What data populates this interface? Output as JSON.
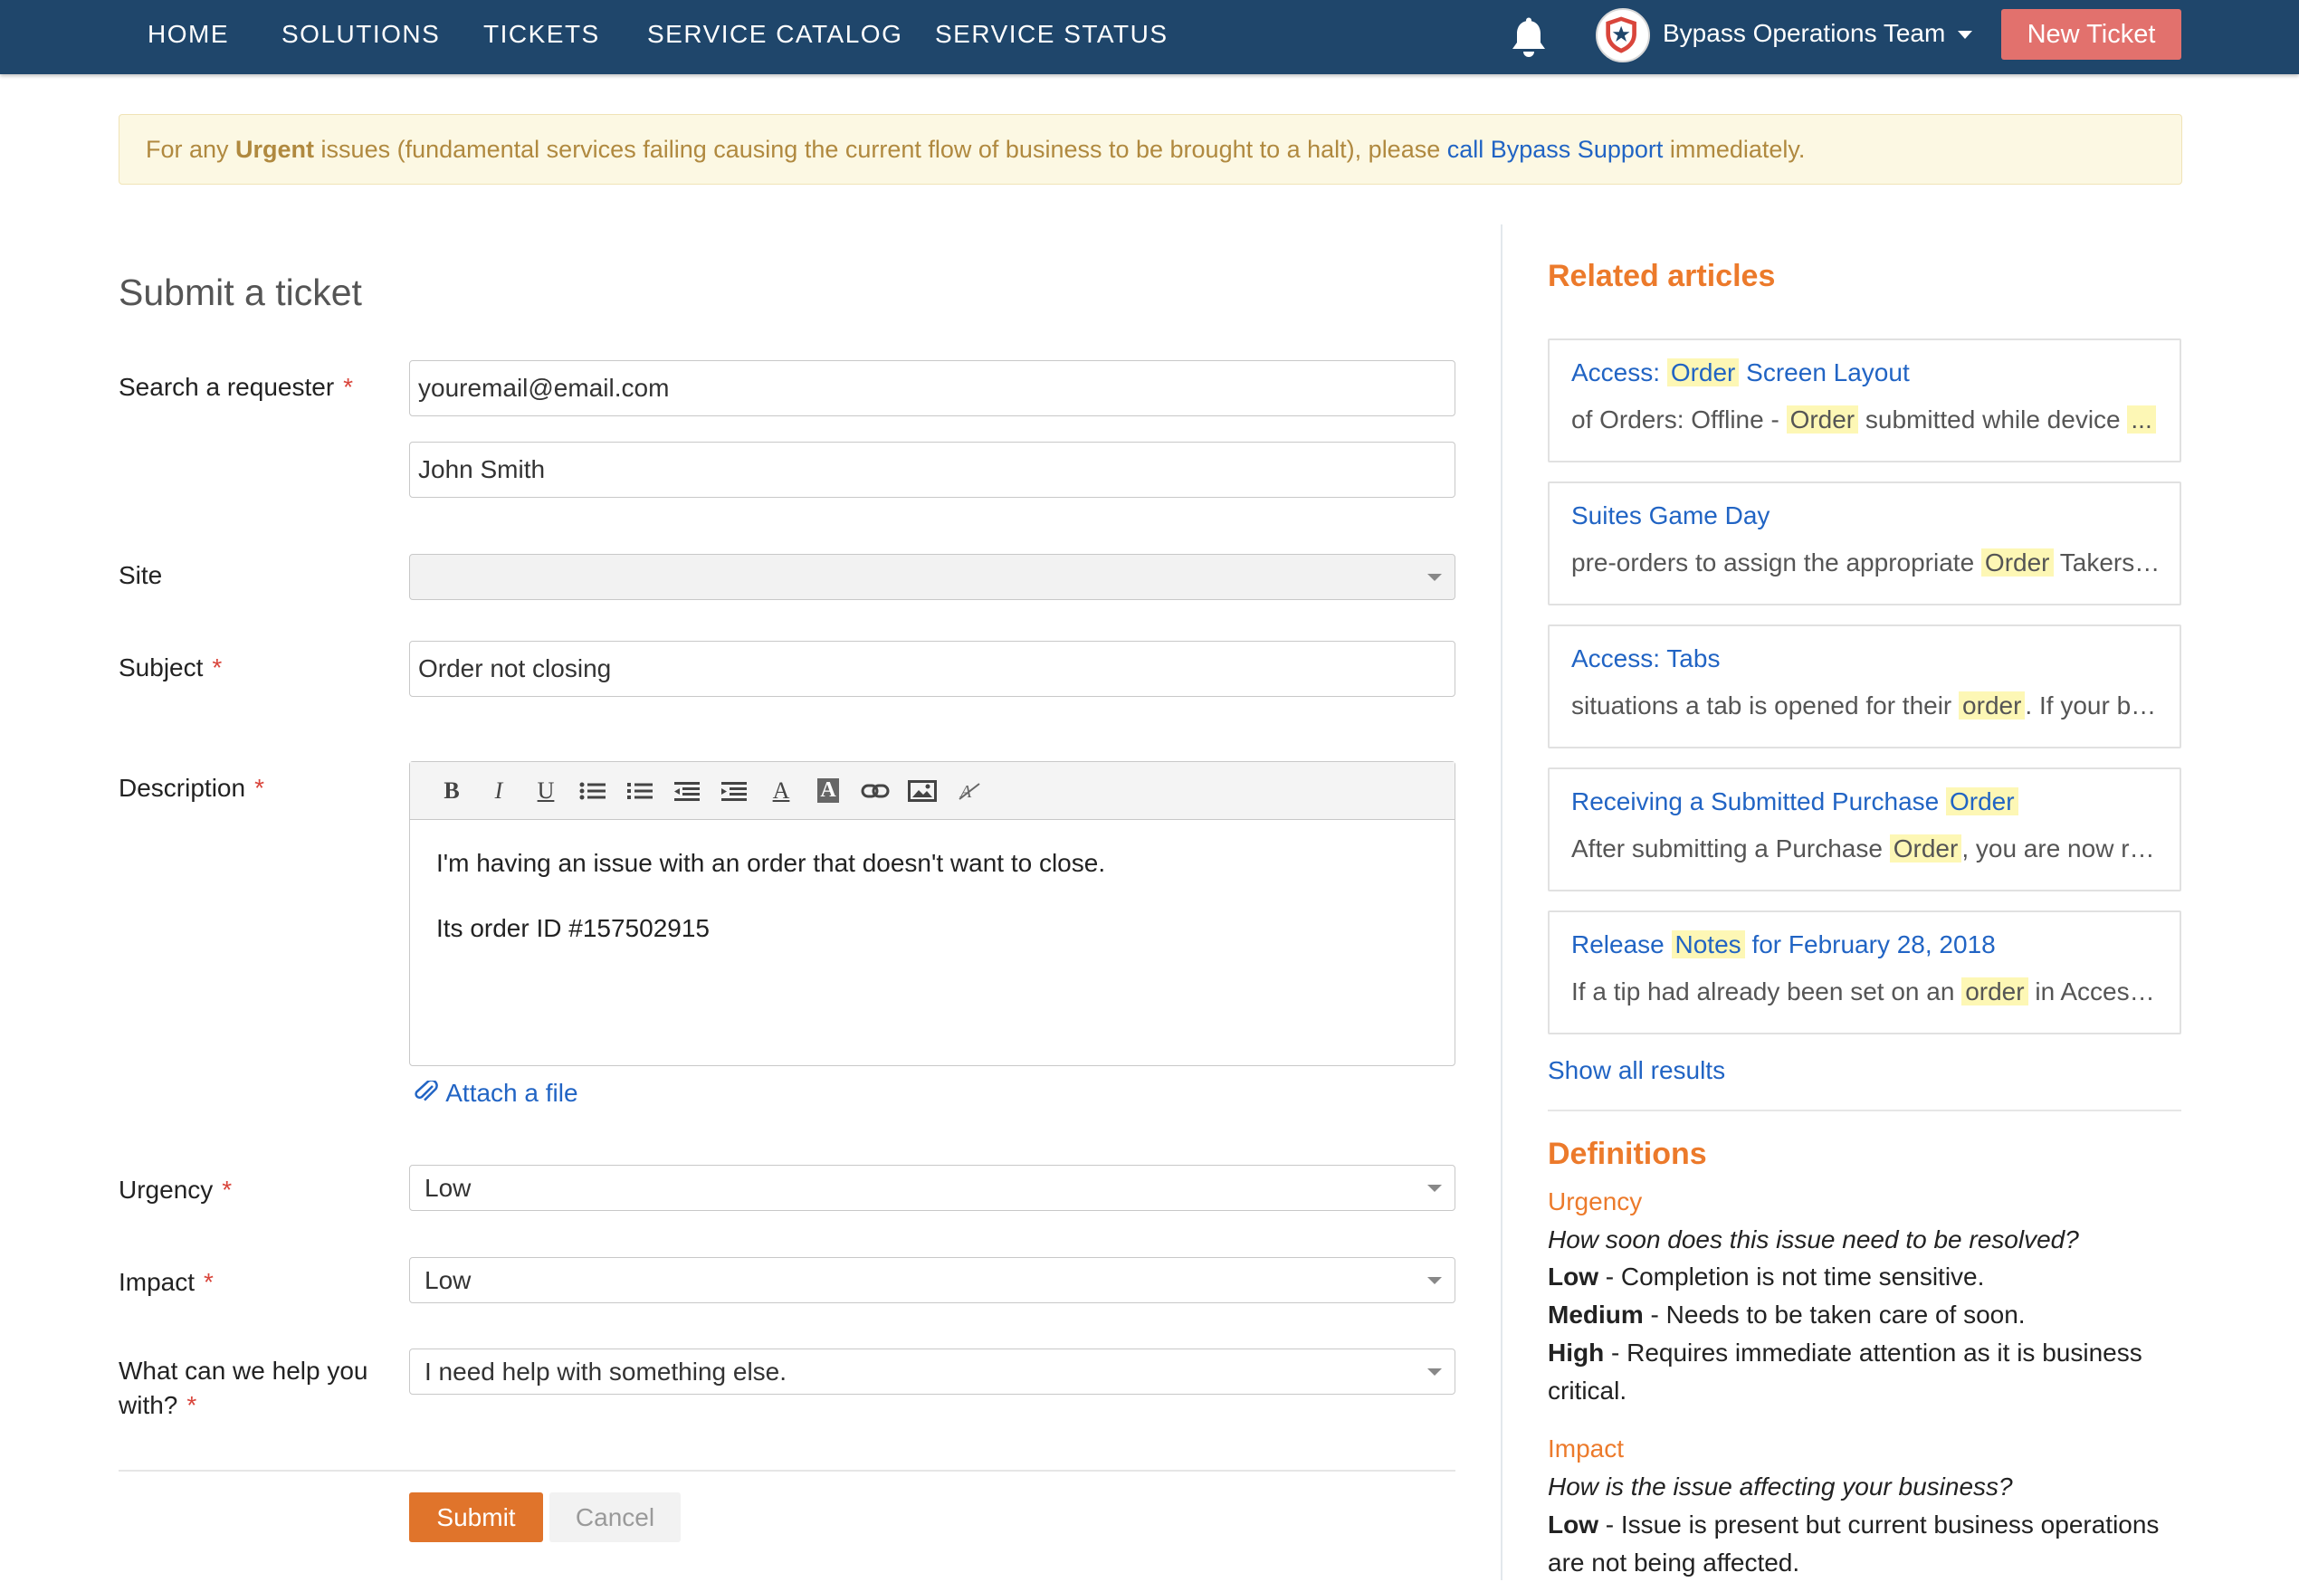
{
  "nav": {
    "items": [
      "HOME",
      "SOLUTIONS",
      "TICKETS",
      "SERVICE CATALOG",
      "SERVICE STATUS"
    ],
    "team_name": "Bypass Operations Team",
    "new_ticket_label": "New Ticket"
  },
  "alert": {
    "prefix": "For any ",
    "urgent": "Urgent",
    "middle": " issues (fundamental services failing causing the current flow of business to be brought to a halt), please ",
    "link": "call Bypass Support",
    "suffix": " immediately."
  },
  "form": {
    "title": "Submit a ticket",
    "requester_label": "Search a requester",
    "requester_email": "youremail@email.com",
    "requester_name": "John Smith",
    "site_label": "Site",
    "site_value": "",
    "subject_label": "Subject",
    "subject_value": "Order not closing",
    "description_label": "Description",
    "description_lines": [
      "I'm having an issue with an order that doesn't want to close.",
      "Its order ID #157502915"
    ],
    "attach_label": "Attach a file",
    "urgency_label": "Urgency",
    "urgency_value": "Low",
    "impact_label": "Impact",
    "impact_value": "Low",
    "help_label_1": "What can we help you",
    "help_label_2": "with?",
    "help_value": "I need help with something else.",
    "required_mark": "*",
    "submit_label": "Submit",
    "cancel_label": "Cancel"
  },
  "toolbar": {
    "bold": "B",
    "italic": "I",
    "underline": "U",
    "font_color": "A",
    "bg_color": "A"
  },
  "related": {
    "heading": "Related articles",
    "articles": [
      {
        "title": [
          {
            "t": "Access: "
          },
          {
            "t": "Order",
            "hl": true
          },
          {
            "t": " Screen Layout"
          }
        ],
        "snippet": [
          {
            "t": "of Orders: Offline - "
          },
          {
            "t": "Order",
            "hl": true
          },
          {
            "t": " submitted while device "
          },
          {
            "t": "...",
            "hl": true
          }
        ]
      },
      {
        "title": [
          {
            "t": "Suites Game Day"
          }
        ],
        "snippet": [
          {
            "t": "pre-orders to assign the appropriate "
          },
          {
            "t": "Order",
            "hl": true
          },
          {
            "t": " Takers and Order Takers"
          }
        ]
      },
      {
        "title": [
          {
            "t": "Access: Tabs"
          }
        ],
        "snippet": [
          {
            "t": "situations a tab is opened for their "
          },
          {
            "t": "order",
            "hl": true
          },
          {
            "t": ". If your business"
          }
        ]
      },
      {
        "title": [
          {
            "t": "Receiving a Submitted Purchase "
          },
          {
            "t": "Order",
            "hl": true
          }
        ],
        "snippet": [
          {
            "t": "After submitting a Purchase "
          },
          {
            "t": "Order",
            "hl": true
          },
          {
            "t": ", you are now ready to receive"
          }
        ]
      },
      {
        "title": [
          {
            "t": "Release "
          },
          {
            "t": "Notes",
            "hl": true
          },
          {
            "t": " for February 28, 2018"
          }
        ],
        "snippet": [
          {
            "t": "If a tip had already been set on an "
          },
          {
            "t": "order",
            "hl": true
          },
          {
            "t": " in Access Manager"
          }
        ]
      }
    ],
    "show_all": "Show all results"
  },
  "definitions": {
    "heading": "Definitions",
    "urgency_term": "Urgency",
    "urgency_q": "How soon does this issue need to be resolved?",
    "urgency_low_b": "Low",
    "urgency_low": " - Completion is not time sensitive.",
    "urgency_med_b": "Medium",
    "urgency_med": " - Needs to be taken care of soon.",
    "urgency_high_b": "High",
    "urgency_high": " - Requires immediate attention as it is business critical.",
    "impact_term": "Impact",
    "impact_q": "How is the issue affecting your business?",
    "impact_low_b": "Low",
    "impact_low": " - Issue is present but current business operations are not being affected."
  },
  "colors": {
    "nav_bg": "#1f466b",
    "new_ticket": "#e2716d",
    "accent_orange": "#ec7a2b",
    "submit": "#e0742b",
    "link": "#2164c4",
    "highlight": "#fdf7b5"
  }
}
